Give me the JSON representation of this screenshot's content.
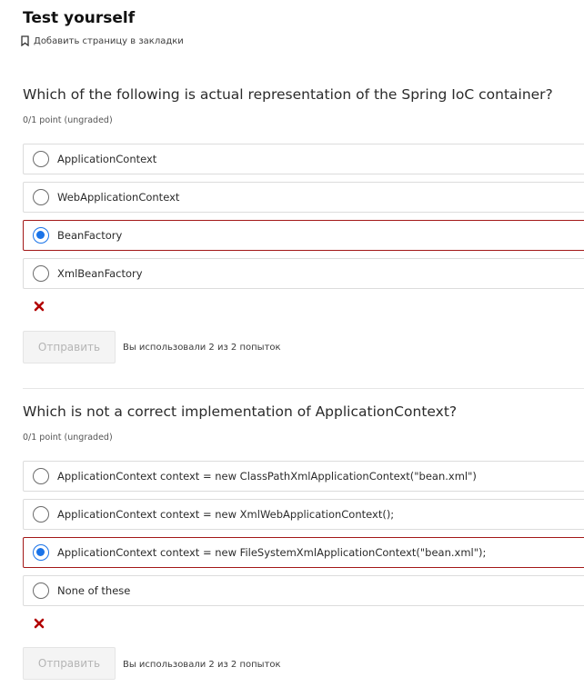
{
  "header": {
    "title": "Test yourself",
    "bookmark_label": "Добавить страницу в закладки"
  },
  "problems": [
    {
      "question": "Which of the following is actual representation of the Spring IoC container?",
      "points": "0/1 point (ungraded)",
      "choices": [
        {
          "label": "ApplicationContext",
          "selected": false
        },
        {
          "label": "WebApplicationContext",
          "selected": false
        },
        {
          "label": "BeanFactory",
          "selected": true
        },
        {
          "label": "XmlBeanFactory",
          "selected": false
        }
      ],
      "status_icon": "incorrect-x-icon",
      "submit_label": "Отправить",
      "attempts_text": "Вы использовали 2 из 2 попыток"
    },
    {
      "question": "Which is not a correct implementation of ApplicationContext?",
      "points": "0/1 point (ungraded)",
      "choices": [
        {
          "label": "ApplicationContext context = new ClassPathXmlApplicationContext(\"bean.xml\")",
          "selected": false
        },
        {
          "label": "ApplicationContext context = new XmlWebApplicationContext();",
          "selected": false
        },
        {
          "label": "ApplicationContext context = new FileSystemXmlApplicationContext(\"bean.xml\");",
          "selected": true
        },
        {
          "label": "None of these",
          "selected": false
        }
      ],
      "status_icon": "incorrect-x-icon",
      "submit_label": "Отправить",
      "attempts_text": "Вы использовали 2 из 2 попыток"
    }
  ],
  "colors": {
    "selected_border": "#a31818",
    "radio_checked": "#1a73e8",
    "incorrect_mark": "#b20000"
  }
}
